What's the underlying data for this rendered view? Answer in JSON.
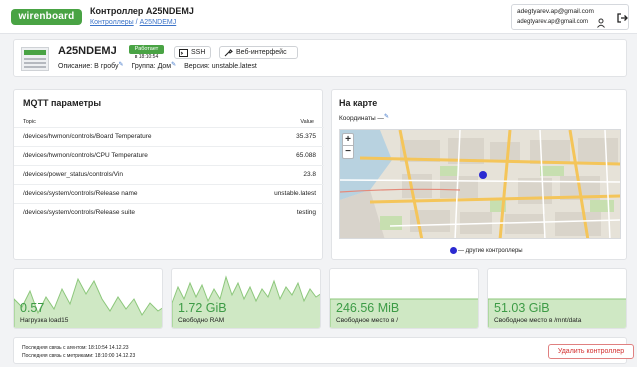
{
  "header": {
    "logo": "wirenboard",
    "title": "Контроллер A25NDEMJ",
    "breadcrumb": [
      "Контроллеры",
      "A25NDEMJ"
    ],
    "account": {
      "email_main": "adegtyarev.ap@gmail.com",
      "email_sub": "adegtyarev.ap@gmail.com",
      "user_icon": "user-icon",
      "logout_icon": "logout-icon"
    }
  },
  "controller": {
    "name": "A25NDEMJ",
    "status": "Работает",
    "status_time": "в 18:10:54",
    "ssh_label": "SSH",
    "web_label": "Веб-интерфейс",
    "description_label": "Описание:",
    "description": "В гробу",
    "group_label": "Группа:",
    "group": "Дом",
    "version_label": "Версия:",
    "version": "unstable.latest",
    "edit_glyph": "✎"
  },
  "mqtt": {
    "title": "MQTT параметры",
    "col_topic": "Topic",
    "col_value": "Value",
    "rows": [
      {
        "topic": "/devices/hwmon/controls/Board Temperature",
        "value": "35.375"
      },
      {
        "topic": "/devices/hwmon/controls/CPU Temperature",
        "value": "65.088"
      },
      {
        "topic": "/devices/power_status/controls/Vin",
        "value": "23.8"
      },
      {
        "topic": "/devices/system/controls/Release name",
        "value": "unstable.latest"
      },
      {
        "topic": "/devices/system/controls/Release suite",
        "value": "testing"
      }
    ]
  },
  "map": {
    "title": "На карте",
    "coords_label": "Координаты —",
    "zoom_in": "+",
    "zoom_out": "−",
    "legend": "— другие контроллеры"
  },
  "metrics": [
    {
      "value": "0.57",
      "label": "Нагрузка load15"
    },
    {
      "value": "1.72 GiB",
      "label": "Свободно RAM"
    },
    {
      "value": "246.56 MiB",
      "label": "Свободное место в /"
    },
    {
      "value": "51.03 GiB",
      "label": "Свободное место в /mnt/data"
    }
  ],
  "footer": {
    "agent_link": "Последняя связь с агентом: 18:10:54 14.12.23",
    "metrics_link": "Последняя связь с метриками: 18:10:00 14.12.23",
    "delete_label": "Удалить контроллер"
  },
  "colors": {
    "accent": "#49a344",
    "link": "#3b73c8",
    "danger": "#d32f2f",
    "marker": "#2b2ad1"
  }
}
